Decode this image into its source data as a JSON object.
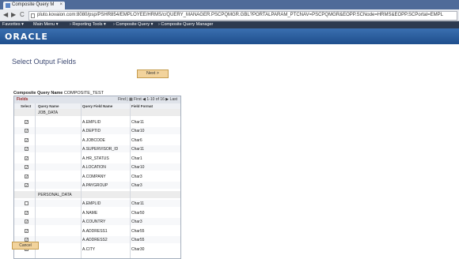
{
  "browser": {
    "tab_title": "Composite Query M",
    "tab_close": "×",
    "nav_back": "◀",
    "nav_forward": "▶",
    "nav_reload": "C",
    "url": "pluto.kovaion.com:8080/psp/PSHR854/EMPLOYEE/HRMS/c/QUERY_MANAGER.PSCPQMGR.GBL?PORTALPARAM_PTCNAV=PSCPQMGR&EOPP.SCNode=HRMS&EOPP.SCPortal=EMPL"
  },
  "menubar": {
    "items": [
      "Favorites ▾",
      "Main Menu ▾",
      "› Reporting Tools ▾",
      "› Composite Query ▾",
      "› Composite Query Manager"
    ]
  },
  "brand": "ORACLE",
  "title": "Select Output Fields",
  "next_label": "Next >",
  "composite_query_label": "Composite Query Name",
  "composite_query_value": "COMPOSITE_TEST",
  "grid": {
    "title": "Fields",
    "nav_text": "Find | ▦   First ◀ 1-10 of 16 ▶ Last",
    "columns": [
      "Select",
      "Query Name",
      "Query Field Name",
      "Field Format"
    ],
    "rows": [
      {
        "checked": false,
        "show_cb": false,
        "query": "JOB_DATA",
        "field": "",
        "format": ""
      },
      {
        "checked": true,
        "show_cb": true,
        "query": "",
        "field": "A.EMPLID",
        "format": "Char11"
      },
      {
        "checked": true,
        "show_cb": true,
        "query": "",
        "field": "A.DEPTID",
        "format": "Char10"
      },
      {
        "checked": true,
        "show_cb": true,
        "query": "",
        "field": "A.JOBCODE",
        "format": "Char6"
      },
      {
        "checked": true,
        "show_cb": true,
        "query": "",
        "field": "A.SUPERVISOR_ID",
        "format": "Char11"
      },
      {
        "checked": true,
        "show_cb": true,
        "query": "",
        "field": "A.HR_STATUS",
        "format": "Char1"
      },
      {
        "checked": true,
        "show_cb": true,
        "query": "",
        "field": "A.LOCATION",
        "format": "Char10"
      },
      {
        "checked": true,
        "show_cb": true,
        "query": "",
        "field": "A.COMPANY",
        "format": "Char3"
      },
      {
        "checked": true,
        "show_cb": true,
        "query": "",
        "field": "A.PAYGROUP",
        "format": "Char3"
      },
      {
        "checked": false,
        "show_cb": false,
        "query": "PERSONAL_DATA",
        "field": "",
        "format": ""
      },
      {
        "checked": false,
        "show_cb": true,
        "query": "",
        "field": "A.EMPLID",
        "format": "Char11"
      },
      {
        "checked": true,
        "show_cb": true,
        "query": "",
        "field": "A.NAME",
        "format": "Char50"
      },
      {
        "checked": true,
        "show_cb": true,
        "query": "",
        "field": "A.COUNTRY",
        "format": "Char3"
      },
      {
        "checked": true,
        "show_cb": true,
        "query": "",
        "field": "A.ADDRESS1",
        "format": "Char55"
      },
      {
        "checked": true,
        "show_cb": true,
        "query": "",
        "field": "A.ADDRESS2",
        "format": "Char55"
      },
      {
        "checked": true,
        "show_cb": true,
        "query": "",
        "field": "A.CITY",
        "format": "Char30"
      }
    ]
  },
  "cancel_label": "Cancel",
  "colors": {
    "menubar": "#2d3a4f",
    "brand_band": "#1f4f8d",
    "button": "#f2d39c",
    "title_text": "#3d4a73"
  }
}
